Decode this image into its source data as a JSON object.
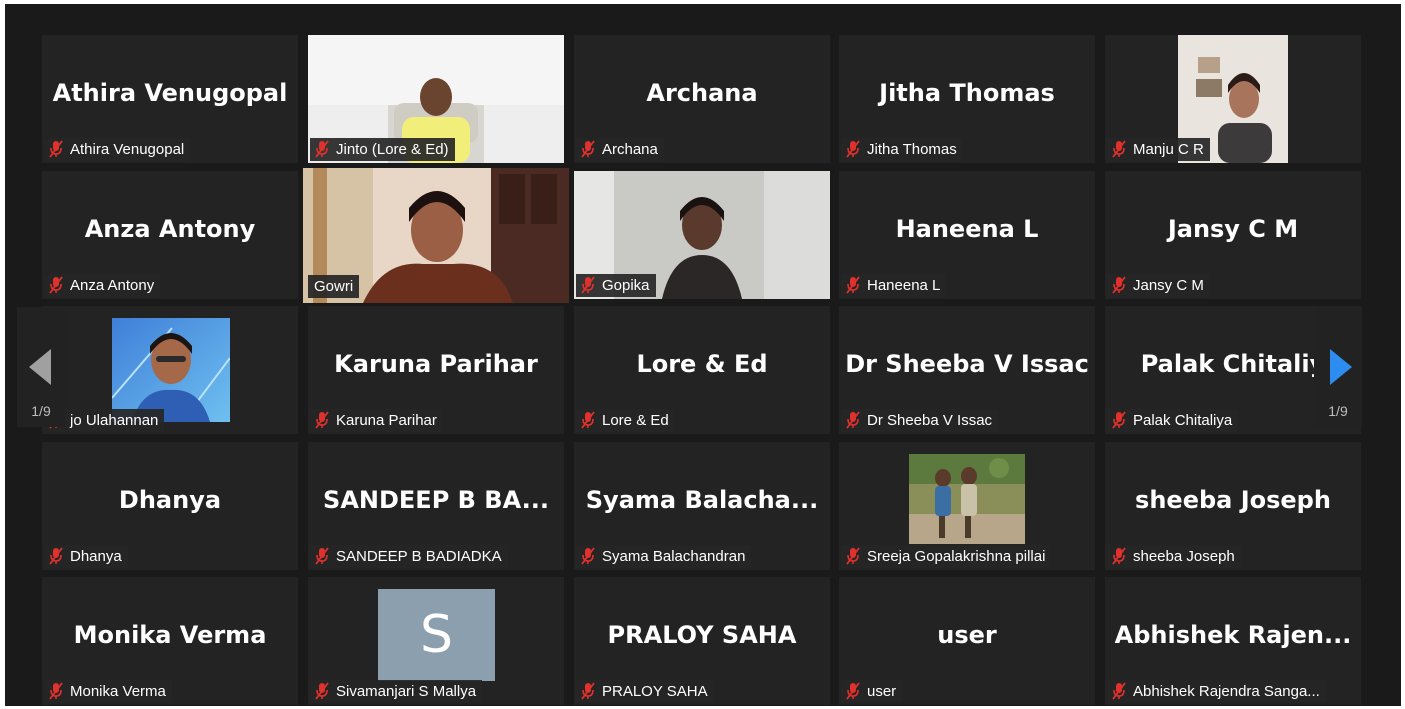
{
  "gallery": {
    "tiles": [
      {
        "display_name": "Athira Venugopal",
        "label": "Athira Venugopal",
        "muted": true
      },
      {
        "display_name": "",
        "label": "Jinto (Lore & Ed)",
        "muted": true
      },
      {
        "display_name": "Archana",
        "label": "Archana",
        "muted": true
      },
      {
        "display_name": "Jitha Thomas",
        "label": "Jitha Thomas",
        "muted": true
      },
      {
        "display_name": "",
        "label": "Manju C R",
        "muted": true
      },
      {
        "display_name": "Anza Antony",
        "label": "Anza Antony",
        "muted": true
      },
      {
        "display_name": "",
        "label": "Gowri",
        "muted": false,
        "active_speaker": true
      },
      {
        "display_name": "",
        "label": "Gopika",
        "muted": true
      },
      {
        "display_name": "Haneena L",
        "label": "Haneena L",
        "muted": true
      },
      {
        "display_name": "Jansy C M",
        "label": "Jansy C M",
        "muted": true
      },
      {
        "display_name": "",
        "label": "jo Ulahannan",
        "muted": true
      },
      {
        "display_name": "Karuna Parihar",
        "label": "Karuna Parihar",
        "muted": true
      },
      {
        "display_name": "Lore & Ed",
        "label": "Lore & Ed",
        "muted": true
      },
      {
        "display_name": "Dr Sheeba V Issac",
        "label": "Dr Sheeba V Issac",
        "muted": true
      },
      {
        "display_name": "Palak Chitaliy",
        "label": "Palak Chitaliya",
        "muted": true
      },
      {
        "display_name": "Dhanya",
        "label": "Dhanya",
        "muted": true
      },
      {
        "display_name": "SANDEEP B BA...",
        "label": "SANDEEP B BADIADKA",
        "muted": true
      },
      {
        "display_name": "Syama Balacha...",
        "label": "Syama Balachandran",
        "muted": true
      },
      {
        "display_name": "",
        "label": "Sreeja Gopalakrishna pillai",
        "muted": true
      },
      {
        "display_name": "sheeba Joseph",
        "label": "sheeba Joseph",
        "muted": true
      },
      {
        "display_name": "Monika Verma",
        "label": "Monika Verma",
        "muted": true
      },
      {
        "display_name": "",
        "label": "Sivamanjari S Mallya",
        "muted": true,
        "avatar_letter": "S"
      },
      {
        "display_name": "PRALOY SAHA",
        "label": "PRALOY SAHA",
        "muted": true
      },
      {
        "display_name": "user",
        "label": "user",
        "muted": true
      },
      {
        "display_name": "Abhishek  Rajen...",
        "label": "Abhishek Rajendra Sanga...",
        "muted": true
      }
    ]
  },
  "pagination": {
    "prev_page_text": "1/9",
    "next_page_text": "1/9"
  },
  "colors": {
    "background": "#1a1a1a",
    "tile": "#232323",
    "muted_icon": "#e0312c",
    "active_speaker_border": "#c9d84a",
    "next_arrow": "#2d8cf0",
    "prev_arrow": "#a0a0a0"
  },
  "icons": {
    "muted": "microphone-muted-icon",
    "prev": "chevron-left-icon",
    "next": "chevron-right-icon"
  }
}
